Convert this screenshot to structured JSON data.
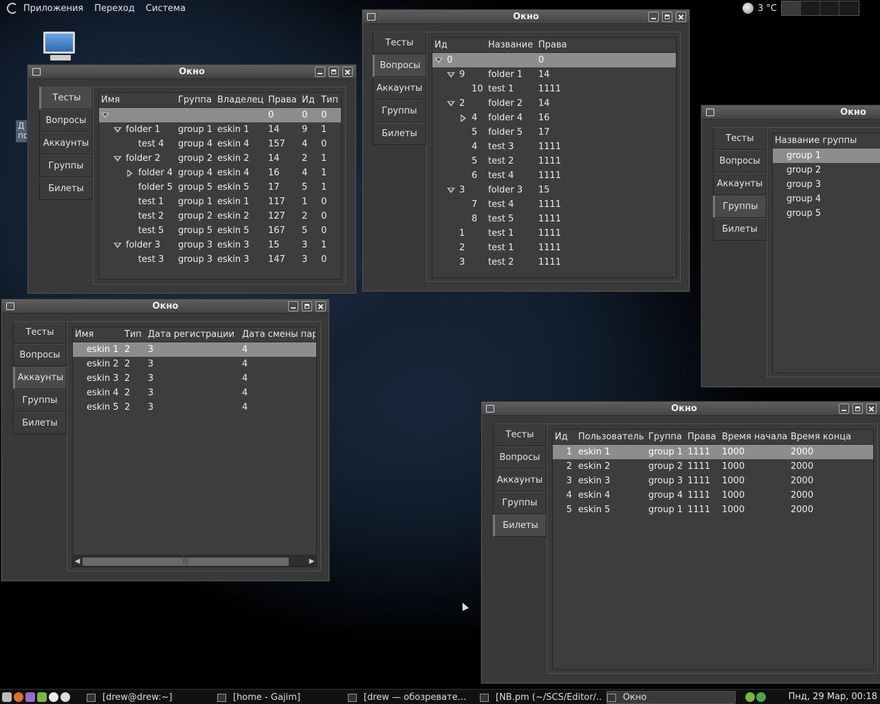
{
  "top_panel": {
    "menus": [
      "Приложения",
      "Переход",
      "Система"
    ],
    "weather": "3 °C"
  },
  "windows": {
    "tests_tree": {
      "title": "Окно",
      "tabs": [
        "Тесты",
        "Вопросы",
        "Аккаунты",
        "Группы",
        "Билеты"
      ],
      "active_tab": 0,
      "columns": [
        "Имя",
        "Группа",
        "Владелец",
        "Права",
        "Ид",
        "Тип"
      ],
      "rows": [
        {
          "level": 0,
          "expander": "open",
          "cells": [
            "",
            "",
            "",
            "0",
            "0",
            "0"
          ],
          "selected": true
        },
        {
          "level": 1,
          "expander": "open",
          "cells": [
            "folder 1",
            "group 1",
            "eskin 1",
            "14",
            "9",
            "1"
          ]
        },
        {
          "level": 2,
          "expander": "",
          "cells": [
            "test 4",
            "group 4",
            "eskin 4",
            "157",
            "4",
            "0"
          ]
        },
        {
          "level": 1,
          "expander": "open",
          "cells": [
            "folder 2",
            "group 2",
            "eskin 2",
            "14",
            "2",
            "1"
          ]
        },
        {
          "level": 2,
          "expander": "closed",
          "cells": [
            "folder 4",
            "group 4",
            "eskin 4",
            "16",
            "4",
            "1"
          ]
        },
        {
          "level": 2,
          "expander": "",
          "cells": [
            "folder 5",
            "group 5",
            "eskin 5",
            "17",
            "5",
            "1"
          ]
        },
        {
          "level": 2,
          "expander": "",
          "cells": [
            "test 1",
            "group 1",
            "eskin 1",
            "117",
            "1",
            "0"
          ]
        },
        {
          "level": 2,
          "expander": "",
          "cells": [
            "test 2",
            "group 2",
            "eskin 2",
            "127",
            "2",
            "0"
          ]
        },
        {
          "level": 2,
          "expander": "",
          "cells": [
            "test 5",
            "group 5",
            "eskin 5",
            "167",
            "5",
            "0"
          ]
        },
        {
          "level": 1,
          "expander": "open",
          "cells": [
            "folder 3",
            "group 3",
            "eskin 3",
            "15",
            "3",
            "1"
          ]
        },
        {
          "level": 2,
          "expander": "",
          "cells": [
            "test 3",
            "group 3",
            "eskin 3",
            "147",
            "3",
            "0"
          ]
        }
      ]
    },
    "questions_tree": {
      "title": "Окно",
      "tabs": [
        "Тесты",
        "Вопросы",
        "Аккаунты",
        "Группы",
        "Билеты"
      ],
      "active_tab": 1,
      "columns": [
        "Ид",
        "Название",
        "Права"
      ],
      "rows": [
        {
          "level": 0,
          "expander": "open",
          "cells": [
            "0",
            "",
            "0"
          ],
          "selected": true
        },
        {
          "level": 1,
          "expander": "open",
          "cells": [
            "9",
            "folder 1",
            "14"
          ]
        },
        {
          "level": 2,
          "expander": "",
          "cells": [
            "10",
            "test 1",
            "1111"
          ]
        },
        {
          "level": 1,
          "expander": "open",
          "cells": [
            "2",
            "folder 2",
            "14"
          ]
        },
        {
          "level": 2,
          "expander": "closed",
          "cells": [
            "4",
            "folder 4",
            "16"
          ]
        },
        {
          "level": 2,
          "expander": "",
          "cells": [
            "5",
            "folder 5",
            "17"
          ]
        },
        {
          "level": 2,
          "expander": "",
          "cells": [
            "4",
            "test 3",
            "1111"
          ]
        },
        {
          "level": 2,
          "expander": "",
          "cells": [
            "5",
            "test 2",
            "1111"
          ]
        },
        {
          "level": 2,
          "expander": "",
          "cells": [
            "6",
            "test 4",
            "1111"
          ]
        },
        {
          "level": 1,
          "expander": "open",
          "cells": [
            "3",
            "folder 3",
            "15"
          ]
        },
        {
          "level": 2,
          "expander": "",
          "cells": [
            "7",
            "test 4",
            "1111"
          ]
        },
        {
          "level": 2,
          "expander": "",
          "cells": [
            "8",
            "test 5",
            "1111"
          ]
        },
        {
          "level": 1,
          "expander": "",
          "cells": [
            "1",
            "test 1",
            "1111"
          ]
        },
        {
          "level": 1,
          "expander": "",
          "cells": [
            "2",
            "test 1",
            "1111"
          ]
        },
        {
          "level": 1,
          "expander": "",
          "cells": [
            "3",
            "test 2",
            "1111"
          ]
        }
      ]
    },
    "groups_list": {
      "title": "Окно",
      "tabs": [
        "Тесты",
        "Вопросы",
        "Аккаунты",
        "Группы",
        "Билеты"
      ],
      "active_tab": 3,
      "columns": [
        "Название группы"
      ],
      "rows": [
        {
          "cells": [
            "group 1"
          ],
          "selected": true
        },
        {
          "cells": [
            "group 2"
          ]
        },
        {
          "cells": [
            "group 3"
          ]
        },
        {
          "cells": [
            "group 4"
          ]
        },
        {
          "cells": [
            "group 5"
          ]
        }
      ]
    },
    "accounts_list": {
      "title": "Окно",
      "tabs": [
        "Тесты",
        "Вопросы",
        "Аккаунты",
        "Группы",
        "Билеты"
      ],
      "active_tab": 2,
      "columns": [
        "Имя",
        "Тип",
        "Дата регистрации",
        "Дата смены пар"
      ],
      "rows": [
        {
          "cells": [
            "eskin 1",
            "2",
            "3",
            "4"
          ],
          "selected": true
        },
        {
          "cells": [
            "eskin 2",
            "2",
            "3",
            "4"
          ]
        },
        {
          "cells": [
            "eskin 3",
            "2",
            "3",
            "4"
          ]
        },
        {
          "cells": [
            "eskin 4",
            "2",
            "3",
            "4"
          ]
        },
        {
          "cells": [
            "eskin 5",
            "2",
            "3",
            "4"
          ]
        }
      ]
    },
    "tickets_list": {
      "title": "Окно",
      "tabs": [
        "Тесты",
        "Вопросы",
        "Аккаунты",
        "Группы",
        "Билеты"
      ],
      "active_tab": 4,
      "columns": [
        "Ид",
        "Пользователь",
        "Группа",
        "Права",
        "Время начала",
        "Время конца"
      ],
      "rows": [
        {
          "cells": [
            "1",
            "eskin 1",
            "group 1",
            "1111",
            "1000",
            "2000"
          ],
          "selected": true
        },
        {
          "cells": [
            "2",
            "eskin 2",
            "group 2",
            "1111",
            "1000",
            "2000"
          ]
        },
        {
          "cells": [
            "3",
            "eskin 3",
            "group 3",
            "1111",
            "1000",
            "2000"
          ]
        },
        {
          "cells": [
            "4",
            "eskin 4",
            "group 4",
            "1111",
            "1000",
            "2000"
          ]
        },
        {
          "cells": [
            "5",
            "eskin 5",
            "group 1",
            "1111",
            "1000",
            "2000"
          ]
        }
      ]
    }
  },
  "taskbar": {
    "tasks": [
      {
        "label": "[drew@drew:~]",
        "icon": "terminal-icon"
      },
      {
        "label": "[home - Gajim]",
        "icon": "gajim-icon"
      },
      {
        "label": "[drew — обозревате...",
        "icon": "file-manager-icon"
      },
      {
        "label": "[NB.pm (~/SCS/Editor/...",
        "icon": "editor-icon"
      },
      {
        "label": "Окно",
        "icon": "window-icon",
        "active": true
      }
    ],
    "clock": "Пнд, 29 Мар, 00:18"
  },
  "desktop": {
    "partial_icon_label": "Д по"
  }
}
